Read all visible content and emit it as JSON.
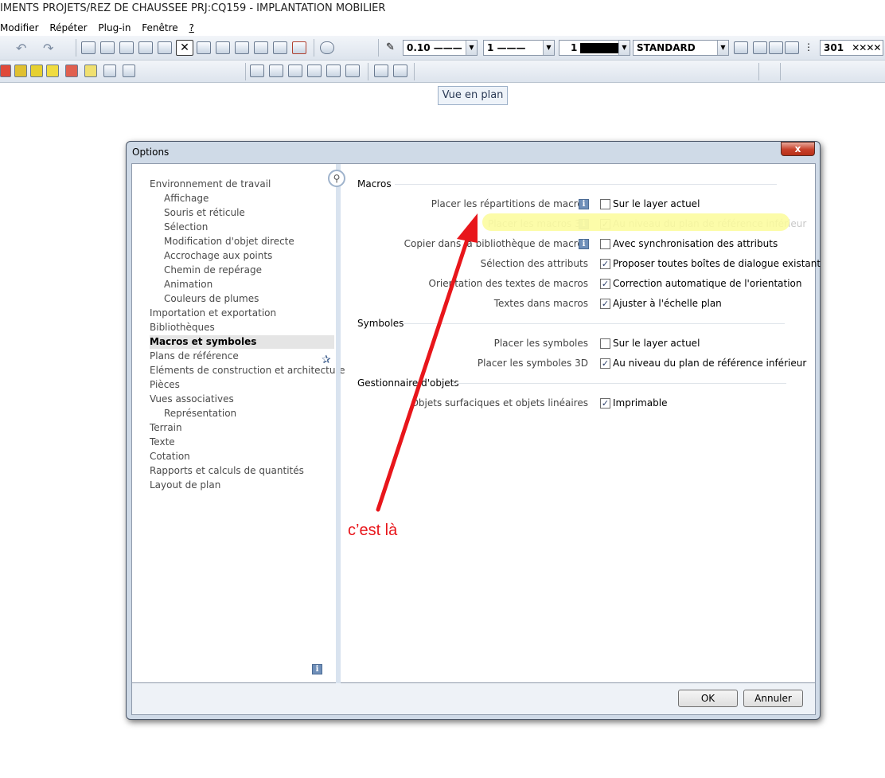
{
  "window": {
    "title": "IMENTS PROJETS/REZ DE CHAUSSEE PRJ:CQ159 - IMPLANTATION MOBILIER"
  },
  "menu": [
    "Modifier",
    "Répéter",
    "Plug-in",
    "Fenêtre",
    "?"
  ],
  "toolbar": {
    "pen_thickness": "0.10 ———",
    "line_type": "1 ———",
    "color": "1",
    "layer": "STANDARD",
    "hatch": "301"
  },
  "tooltip": "Vue en plan",
  "dialog": {
    "title": "Options",
    "close_label": "x",
    "ok_label": "OK",
    "cancel_label": "Annuler",
    "tree": [
      {
        "label": "Environnement de travail",
        "level": 0
      },
      {
        "label": "Affichage",
        "level": 1
      },
      {
        "label": "Souris et réticule",
        "level": 1
      },
      {
        "label": "Sélection",
        "level": 1
      },
      {
        "label": "Modification d'objet directe",
        "level": 1
      },
      {
        "label": "Accrochage aux points",
        "level": 1
      },
      {
        "label": "Chemin de repérage",
        "level": 1
      },
      {
        "label": "Animation",
        "level": 1
      },
      {
        "label": "Couleurs de plumes",
        "level": 1
      },
      {
        "label": "Importation et exportation",
        "level": 0
      },
      {
        "label": "Bibliothèques",
        "level": 0
      },
      {
        "label": "Macros et symboles",
        "level": 0,
        "selected": true
      },
      {
        "label": "Plans de référence",
        "level": 0
      },
      {
        "label": "Eléments de construction et architecture",
        "level": 0
      },
      {
        "label": "Pièces",
        "level": 0
      },
      {
        "label": "Vues associatives",
        "level": 0
      },
      {
        "label": "Représentation",
        "level": 1
      },
      {
        "label": "Terrain",
        "level": 0
      },
      {
        "label": "Texte",
        "level": 0
      },
      {
        "label": "Cotation",
        "level": 0
      },
      {
        "label": "Rapports et calculs de quantités",
        "level": 0
      },
      {
        "label": "Layout de plan",
        "level": 0
      }
    ],
    "sections": {
      "macros": {
        "title": "Macros",
        "rows": [
          {
            "label": "Placer les répartitions de macros",
            "info": true,
            "checked": false,
            "option": "Sur le layer actuel"
          },
          {
            "label": "Placer les macros 3D",
            "info": true,
            "checked": true,
            "option": "Au  niveau du plan de référence inférieur",
            "disabled": true
          },
          {
            "label": "Copier dans la bibliothèque de macros",
            "info": true,
            "checked": false,
            "option": "Avec synchronisation des attributs"
          },
          {
            "label": "Sélection des attributs",
            "info": false,
            "checked": true,
            "option": "Proposer toutes boîtes de dialogue existant"
          },
          {
            "label": "Orientation des textes de macros",
            "info": false,
            "checked": true,
            "option": "Correction automatique de l'orientation"
          },
          {
            "label": "Textes dans macros",
            "info": false,
            "checked": true,
            "option": "Ajuster à l'échelle plan"
          }
        ]
      },
      "symboles": {
        "title": "Symboles",
        "rows": [
          {
            "label": "Placer les symboles",
            "checked": false,
            "option": "Sur le layer actuel"
          },
          {
            "label": "Placer les symboles 3D",
            "checked": true,
            "option": "Au niveau du plan de référence inférieur"
          }
        ]
      },
      "gestionnaire": {
        "title": "Gestionnaire d'objets",
        "rows": [
          {
            "label": "Objets surfaciques et objets linéaires",
            "checked": true,
            "option": "Imprimable"
          }
        ]
      }
    }
  },
  "annotation": {
    "text": "c’est là",
    "color": "#e8161b"
  }
}
